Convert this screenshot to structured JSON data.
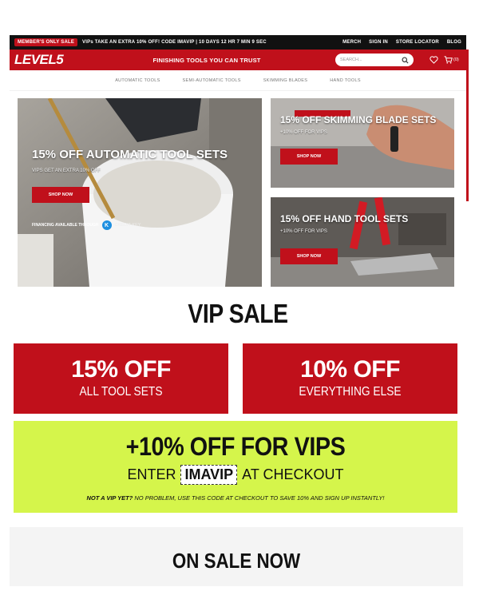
{
  "promo_bar": {
    "badge": "MEMBER'S ONLY SALE",
    "text": "VIPs TAKE AN EXTRA 10% OFF! CODE IMAVIP | 10 DAYS 12 HR 7 MIN 9 SEC",
    "links": [
      "MERCH",
      "SIGN IN",
      "STORE LOCATOR",
      "BLOG"
    ]
  },
  "header": {
    "logo": "LEVEL5",
    "tagline": "FINISHING TOOLS YOU CAN TRUST",
    "search_placeholder": "SEARCH...",
    "cart_count": "(0)"
  },
  "nav": [
    "AUTOMATIC TOOLS",
    "SEMI-AUTOMATIC TOOLS",
    "SKIMMING BLADES",
    "HAND TOOLS"
  ],
  "hero": {
    "main": {
      "title": "15% OFF AUTOMATIC TOOL SETS",
      "subtitle": "VIPS GET AN EXTRA 10% OFF",
      "button": "SHOP NOW",
      "financing": "FINANCING AVAILABLE THROUGH",
      "financing_partner": "CREDIT KEY"
    },
    "side1": {
      "title": "15% OFF SKIMMING BLADE SETS",
      "subtitle": "+10% OFF FOR VIPS",
      "button": "SHOP NOW"
    },
    "side2": {
      "title": "15% OFF HAND TOOL SETS",
      "subtitle": "+10% OFF FOR VIPS",
      "button": "SHOP NOW"
    }
  },
  "vip": {
    "title": "VIP SALE",
    "box1_big": "15% OFF",
    "box1_small": "ALL TOOL SETS",
    "box2_big": "10% OFF",
    "box2_small": "EVERYTHING ELSE",
    "vip_big": "+10% OFF FOR VIPS",
    "enter": "ENTER",
    "code": "IMAVIP",
    "at_checkout": "AT CHECKOUT",
    "fine_bold": "NOT A VIP YET?",
    "fine_rest": " NO PROBLEM, USE THIS CODE AT CHECKOUT TO SAVE 10% AND SIGN UP INSTANTLY!"
  },
  "on_sale": {
    "title": "ON SALE NOW"
  },
  "colors": {
    "brand_red": "#c0101b",
    "vip_green": "#d5f54b",
    "promo_black": "#111111"
  }
}
